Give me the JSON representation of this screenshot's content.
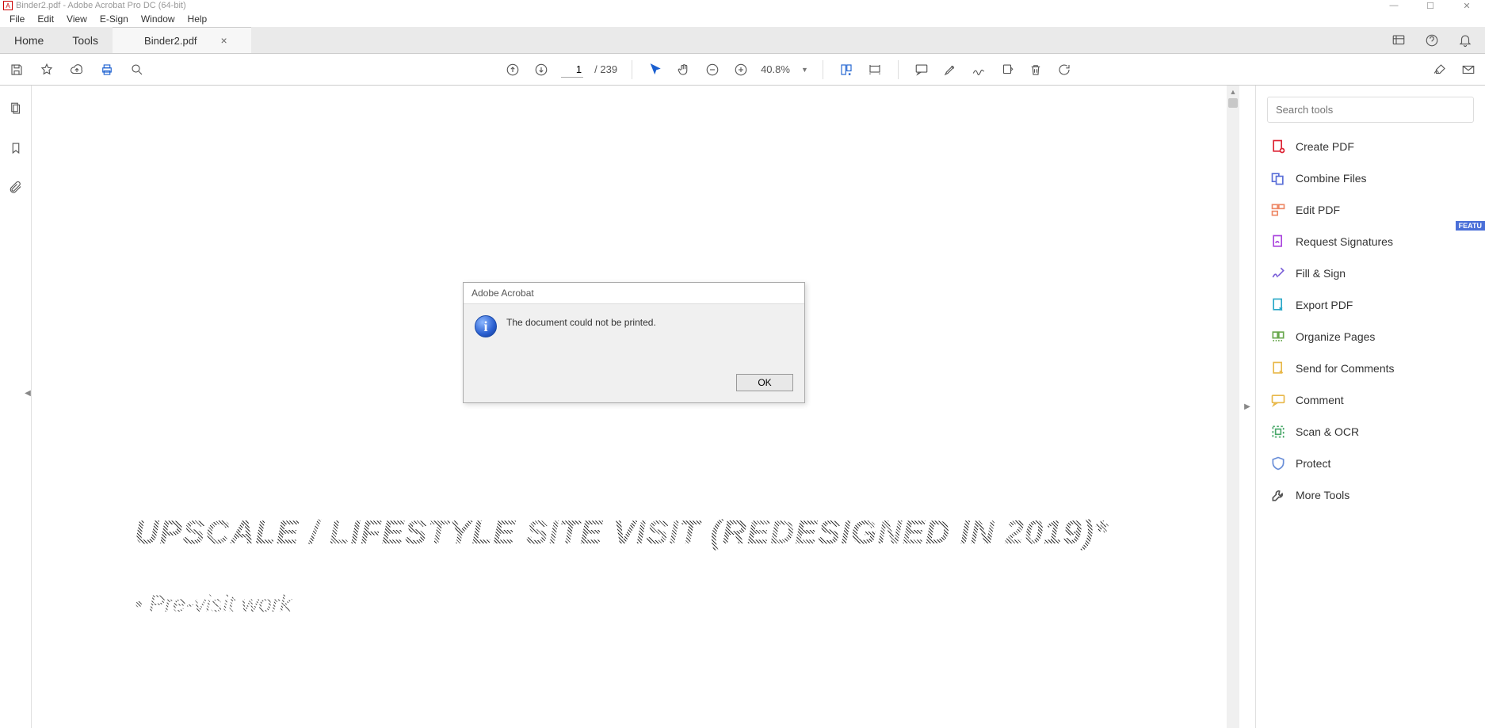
{
  "window": {
    "title": "Binder2.pdf - Adobe Acrobat Pro DC (64-bit)"
  },
  "menu": [
    "File",
    "Edit",
    "View",
    "E-Sign",
    "Window",
    "Help"
  ],
  "tabs": {
    "home": "Home",
    "tools": "Tools",
    "active": "Binder2.pdf"
  },
  "toolbar": {
    "page_current": "1",
    "page_total": "/ 239",
    "zoom": "40.8%"
  },
  "right_panel": {
    "search_placeholder": "Search tools",
    "items": [
      {
        "label": "Create PDF",
        "color": "#d23"
      },
      {
        "label": "Combine Files",
        "color": "#5a6fd8"
      },
      {
        "label": "Edit PDF",
        "color": "#e86"
      },
      {
        "label": "Request Signatures",
        "color": "#a4d",
        "badge": "FEATU"
      },
      {
        "label": "Fill & Sign",
        "color": "#7a5fd8"
      },
      {
        "label": "Export PDF",
        "color": "#2aa8c8"
      },
      {
        "label": "Organize Pages",
        "color": "#6aa84f"
      },
      {
        "label": "Send for Comments",
        "color": "#e8b84a"
      },
      {
        "label": "Comment",
        "color": "#e8b84a"
      },
      {
        "label": "Scan & OCR",
        "color": "#4aa86a"
      },
      {
        "label": "Protect",
        "color": "#6a8fd8"
      },
      {
        "label": "More Tools",
        "color": "#555"
      }
    ]
  },
  "dialog": {
    "title": "Adobe Acrobat",
    "message": "The document could not be printed.",
    "ok": "OK"
  },
  "document": {
    "heading": "UPSCALE / LIFESTYLE SITE VISIT (REDESIGNED IN 2019)*",
    "bullet1": "Pre-visit work"
  }
}
